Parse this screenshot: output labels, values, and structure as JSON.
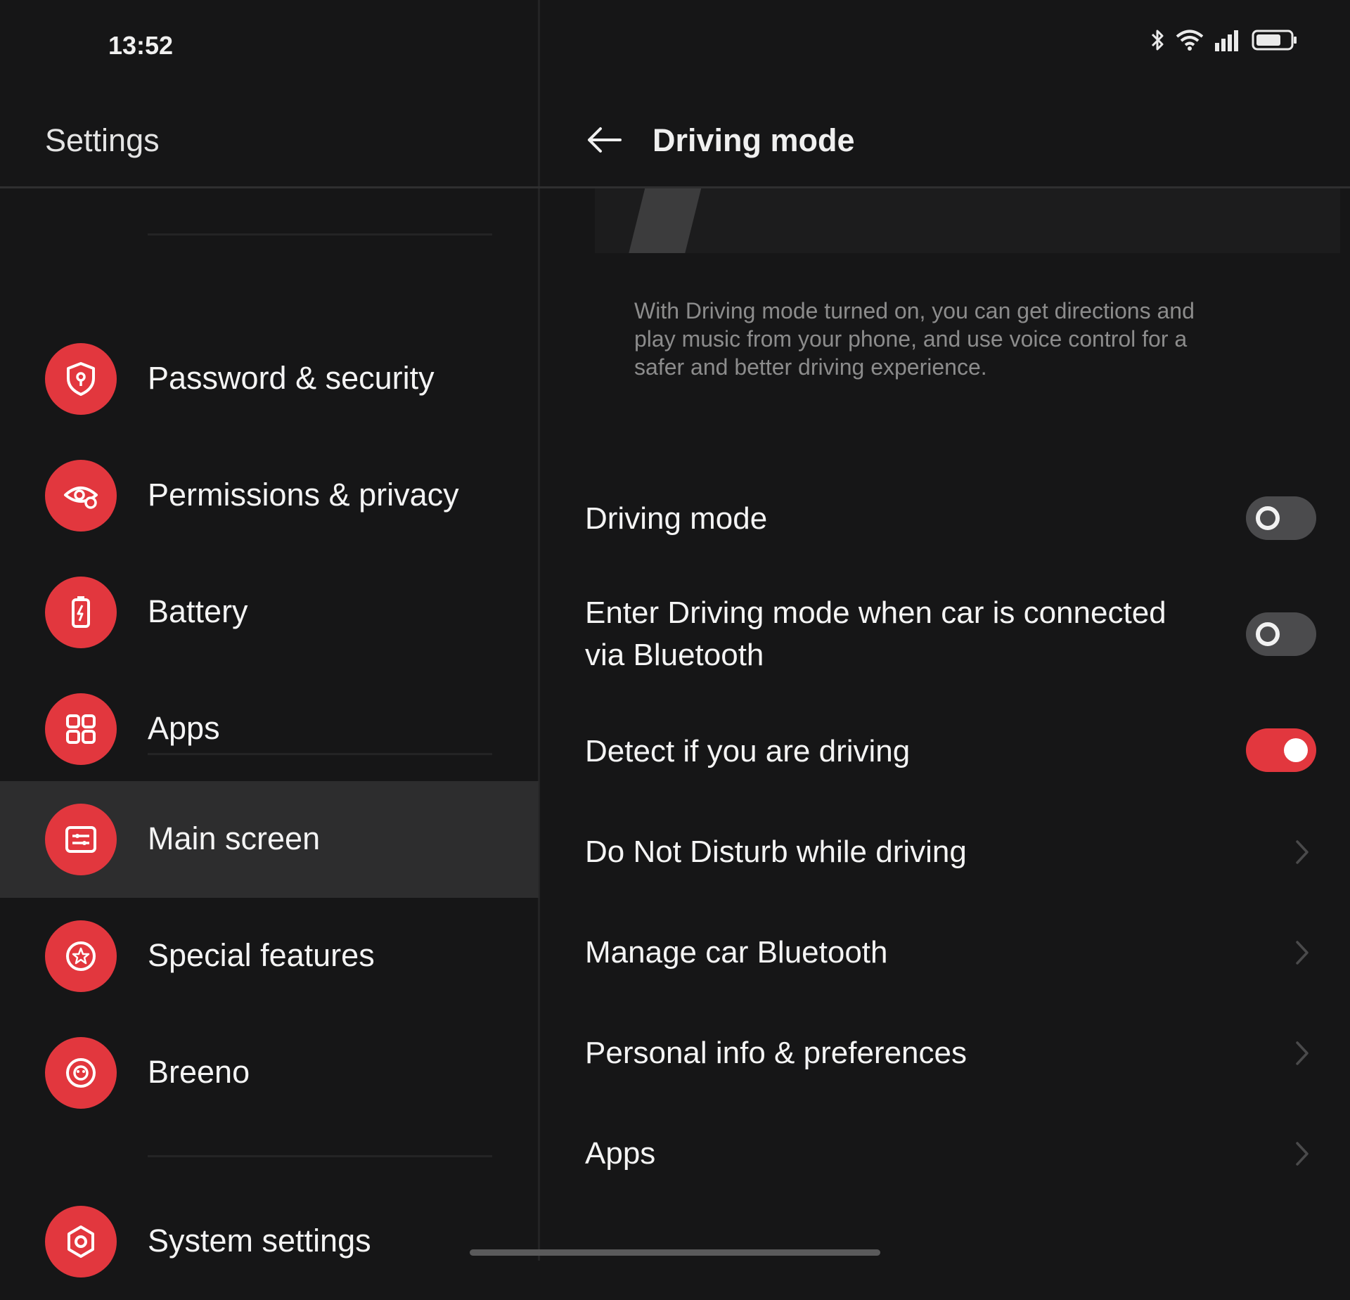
{
  "status_bar": {
    "time": "13:52",
    "icons": [
      "bluetooth-icon",
      "wifi-icon",
      "signal-icon",
      "battery-icon"
    ]
  },
  "left_pane": {
    "title": "Settings",
    "items": [
      {
        "label": "Password & security",
        "icon": "shield-lock-icon",
        "selected": false
      },
      {
        "label": "Permissions & privacy",
        "icon": "eye-lock-icon",
        "selected": false
      },
      {
        "label": "Battery",
        "icon": "battery-charging-icon",
        "selected": false
      },
      {
        "label": "Apps",
        "icon": "grid-apps-icon",
        "selected": false
      },
      {
        "label": "Main screen",
        "icon": "main-screen-icon",
        "selected": true
      },
      {
        "label": "Special features",
        "icon": "star-badge-icon",
        "selected": false
      },
      {
        "label": "Breeno",
        "icon": "breeno-icon",
        "selected": false
      },
      {
        "label": "System settings",
        "icon": "gear-icon",
        "selected": false
      }
    ]
  },
  "right_pane": {
    "title": "Driving mode",
    "description": "With Driving mode turned on, you can get directions and play music from your phone, and use voice control for a safer and better driving experience.",
    "settings": [
      {
        "label": "Driving mode",
        "control": "toggle",
        "value": false
      },
      {
        "label": "Enter Driving mode when car is connected via Bluetooth",
        "control": "toggle",
        "value": false
      },
      {
        "label": "Detect if you are driving",
        "control": "toggle",
        "value": true
      },
      {
        "label": "Do Not Disturb while driving",
        "control": "chevron"
      },
      {
        "label": "Manage car Bluetooth",
        "control": "chevron"
      },
      {
        "label": "Personal info & preferences",
        "control": "chevron"
      },
      {
        "label": "Apps",
        "control": "chevron"
      }
    ]
  },
  "colors": {
    "accent": "#e2373e",
    "background": "#161617",
    "selected_row": "#2d2d2e",
    "description_text": "#8c8c8c"
  }
}
